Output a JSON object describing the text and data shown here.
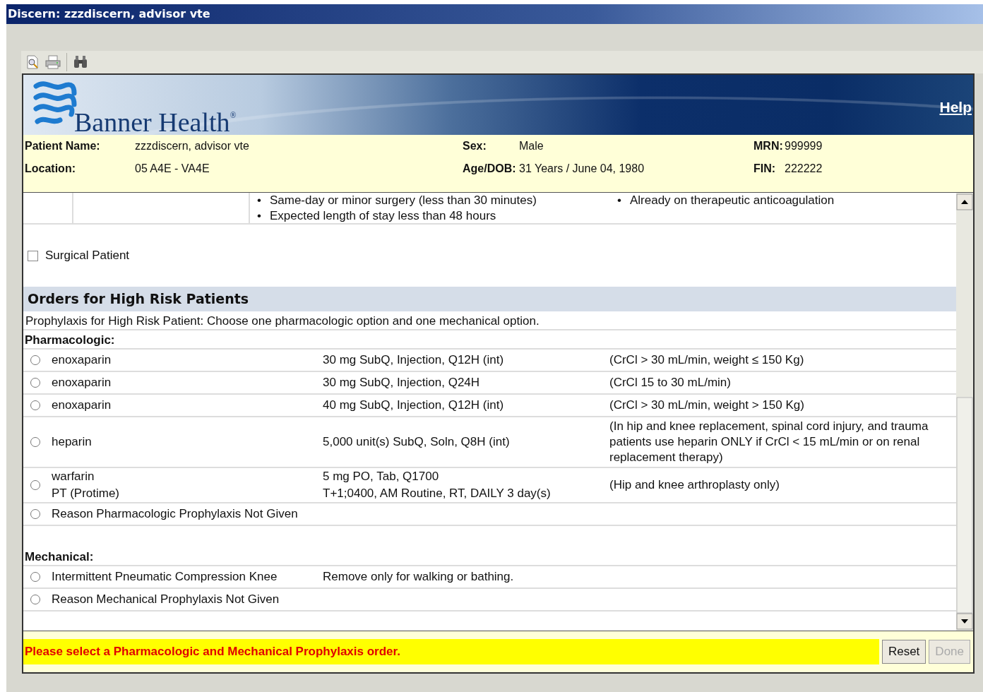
{
  "window": {
    "title": "Discern: zzzdiscern, advisor vte"
  },
  "header": {
    "logo_text": "Banner Health$^{®}$",
    "help_link": "Help"
  },
  "patient": {
    "columns": [
      [
        {
          "label": "Patient Name:",
          "value": "zzzdiscern, advisor vte"
        },
        {
          "label": "Location:",
          "value": "05 A4E - VA4E"
        }
      ],
      [
        {
          "label": "Sex:",
          "value": "Male"
        },
        {
          "label": "Age/DOB:",
          "value": "31 Years / June 04, 1980"
        }
      ],
      [
        {
          "label": "MRN:",
          "value": "999999"
        },
        {
          "label": "FIN:",
          "value": "222222"
        }
      ]
    ]
  },
  "criteria_row": {
    "column_1": [
      {
        "marker": "•",
        "text": "Same-day or minor surgery (less than 30 minutes)"
      },
      {
        "marker": "•",
        "text": "Expected length of stay less than 48 hours"
      }
    ],
    "column_2": [
      {
        "marker": "•",
        "text": "Already on therapeutic anticoagulation"
      }
    ]
  },
  "surgical_patient": {
    "label": "Surgical Patient",
    "checked": false
  },
  "section": {
    "title": "Orders for High Risk Patients",
    "instruction": "Prophylaxis for High Risk Patient: Choose one pharmacologic option and one mechanical option.",
    "groups": [
      {
        "heading": "Pharmacologic:",
        "orders": [
          {
            "name": [
              "enoxaparin"
            ],
            "details": [
              "30 mg SubQ, Injection, Q12H (int)"
            ],
            "comment": "(CrCl > 30 mL/min, weight ≤ 150 Kg)",
            "selected": false
          },
          {
            "name": [
              "enoxaparin"
            ],
            "details": [
              "30 mg SubQ, Injection, Q24H"
            ],
            "comment": "(CrCl 15 to 30 mL/min)",
            "selected": false
          },
          {
            "name": [
              "enoxaparin"
            ],
            "details": [
              "40 mg SubQ, Injection, Q12H (int)"
            ],
            "comment": "(CrCl > 30 mL/min, weight > 150 Kg)",
            "selected": false
          },
          {
            "name": [
              "heparin"
            ],
            "details": [
              "5,000 unit(s) SubQ, Soln, Q8H (int)"
            ],
            "comment": "(In hip and knee replacement, spinal cord injury, and trauma patients use heparin ONLY if CrCl < 15 mL/min or on renal replacement therapy)",
            "selected": false
          },
          {
            "name": [
              "warfarin",
              "PT (Protime)"
            ],
            "details": [
              "5 mg PO, Tab, Q1700",
              "T+1;0400, AM Routine, RT, DAILY 3 day(s)"
            ],
            "comment": "(Hip and knee arthroplasty only)",
            "selected": false
          },
          {
            "name": [
              "Reason Pharmacologic Prophylaxis Not Given"
            ],
            "selected": false
          }
        ]
      },
      {
        "heading": "Mechanical:",
        "orders": [
          {
            "name": [
              "Intermittent Pneumatic Compression Knee"
            ],
            "details": [
              "Remove only for walking or bathing."
            ],
            "selected": false
          },
          {
            "name": [
              "Reason Mechanical Prophylaxis Not Given"
            ],
            "selected": false
          }
        ]
      }
    ]
  },
  "footer": {
    "message": "Please select a Pharmacologic and Mechanical Prophylaxis order.",
    "buttons": [
      {
        "label": "Reset",
        "disabled": false
      },
      {
        "label": "Done",
        "disabled": true
      }
    ]
  }
}
